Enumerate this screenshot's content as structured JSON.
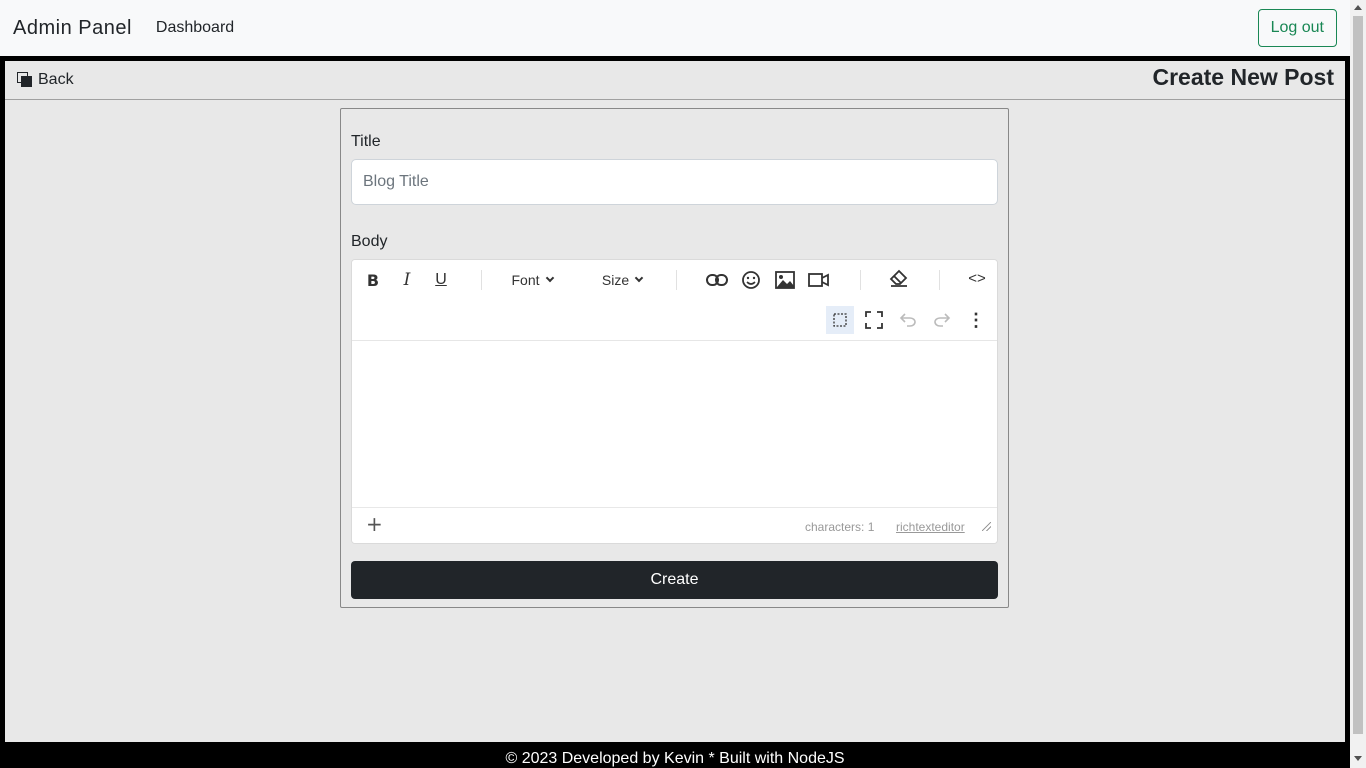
{
  "navbar": {
    "brand": "Admin Panel",
    "dashboard_link": "Dashboard",
    "logout_label": "Log out"
  },
  "header": {
    "back_label": "Back",
    "page_title": "Create New Post"
  },
  "form": {
    "title_label": "Title",
    "title_placeholder": "Blog Title",
    "title_value": "",
    "body_label": "Body",
    "create_label": "Create"
  },
  "editor": {
    "toolbar": {
      "bold": "B",
      "italic": "I",
      "underline": "U",
      "font_label": "Font",
      "size_label": "Size",
      "code_view": "<>",
      "more": "⋮"
    },
    "status": {
      "add": "+",
      "characters": "characters: 1",
      "brand_link": "richtexteditor"
    },
    "icons": [
      "bold-icon",
      "italic-icon",
      "underline-icon",
      "link-icon",
      "emoji-icon",
      "image-icon",
      "video-icon",
      "eraser-icon",
      "code-icon",
      "show-blocks-icon",
      "fullscreen-icon",
      "undo-icon",
      "redo-icon",
      "more-icon"
    ]
  },
  "footer": {
    "text": "© 2023 Developed by Kevin * Built with NodeJS"
  },
  "colors": {
    "accent_success": "#198754",
    "button_dark": "#212529",
    "page_bg": "#e8e8e8"
  }
}
